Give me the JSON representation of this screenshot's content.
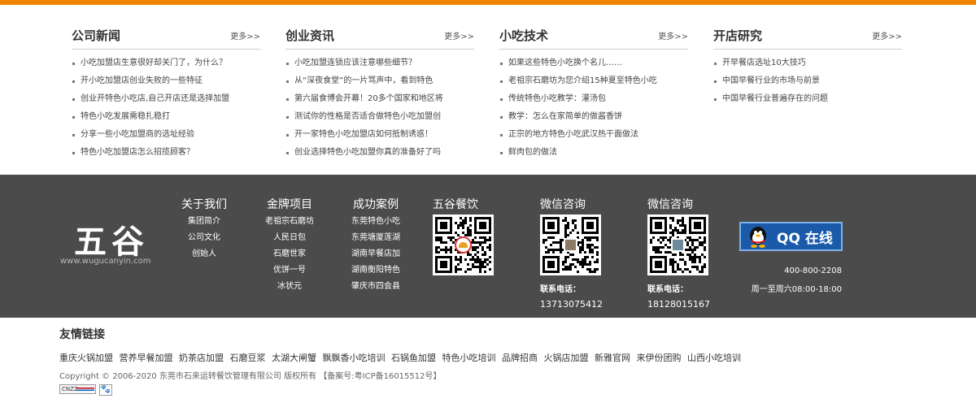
{
  "columns": [
    {
      "title": "公司新闻",
      "more": "更多>>",
      "items": [
        "小吃加盟店生意很好却关门了，为什么？",
        "开小吃加盟店创业失败的一些特征",
        "创业开特色小吃店,自己开店还是选择加盟",
        "特色小吃发展需稳扎稳打",
        "分享一些小吃加盟商的选址经验",
        "特色小吃加盟店怎么招揽顾客？"
      ]
    },
    {
      "title": "创业资讯",
      "more": "更多>>",
      "items": [
        "小吃加盟连锁应该注意哪些细节？",
        "从“深夜食堂”的一片骂声中，看到特色",
        "第六届食博会开幕！20多个国家和地区将",
        "测试你的性格是否适合做特色小吃加盟创",
        "开一家特色小吃加盟店如何抵制诱惑！",
        "创业选择特色小吃加盟你真的准备好了吗"
      ]
    },
    {
      "title": "小吃技术",
      "more": "更多>>",
      "items": [
        "如果这些特色小吃换个名儿……",
        "老祖宗石磨坊为您介绍15种夏至特色小吃",
        "传统特色小吃教学：灌汤包",
        "教学：怎么在家简单的做酱香饼",
        "正宗的地方特色小吃武汉热干面做法",
        "鲜肉包的做法"
      ]
    },
    {
      "title": "开店研究",
      "more": "更多>>",
      "items": [
        "开早餐店选址10大技巧",
        "中国早餐行业的市场与前景",
        "中国早餐行业普遍存在的问题"
      ]
    }
  ],
  "footer": {
    "logo": "五谷",
    "logo_url": "www.wugucanyin.com",
    "nav": [
      {
        "title": "关于我们",
        "items": [
          "集团简介",
          "公司文化",
          "创始人"
        ]
      },
      {
        "title": "金牌项目",
        "items": [
          "老祖宗石磨坊",
          "人民日包",
          "石磨世家",
          "优饼一号",
          "冰状元"
        ]
      },
      {
        "title": "成功案例",
        "items": [
          "东莞特色小吃",
          "东莞塘厦莲湖",
          "湖南早餐店加",
          "湖南衡阳特色",
          "肇庆市四会县"
        ]
      }
    ],
    "qrcodes": [
      {
        "title": "五谷餐饮",
        "label": "",
        "phone": ""
      },
      {
        "title": "微信咨询",
        "label": "联系电话：",
        "phone": "13713075412"
      },
      {
        "title": "微信咨询",
        "label": "联系电话：",
        "phone": "18128015167"
      }
    ],
    "qq_label": "QQ 在线",
    "phone": "400-800-2208",
    "hours": "周一至周六08:00-18:00"
  },
  "friend_links": {
    "title": "友情链接",
    "items": [
      "重庆火锅加盟",
      "营养早餐加盟",
      "奶茶店加盟",
      "石磨豆浆",
      "太湖大闸蟹",
      "飘飘香小吃培训",
      "石锅鱼加盟",
      "特色小吃培训",
      "品牌招商",
      "火锅店加盟",
      "新雅官网",
      "来伊份团购",
      "山西小吃培训"
    ]
  },
  "copyright": "Copyright © 2006-2020 东莞市石来运转餐饮管理有限公司 版权所有 【备案号:粤ICP备16015512号】",
  "badges": {
    "cnzz": "CNZZ",
    "paw": "🐾"
  },
  "colors": {
    "accent": "#f08300",
    "footer_bg": "#4b4b4b",
    "qq_blue": "#1a5aa8"
  }
}
